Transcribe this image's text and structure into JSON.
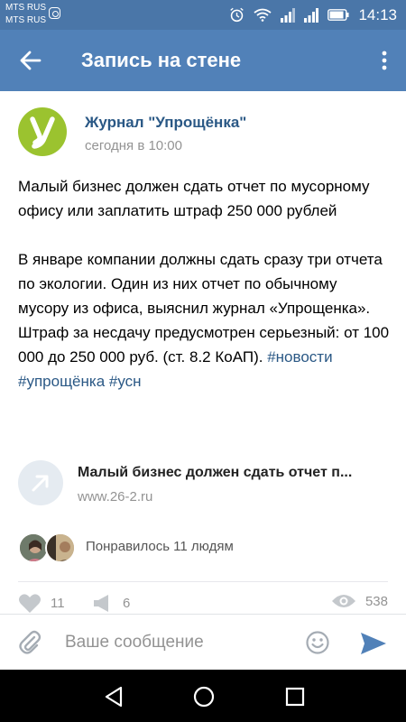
{
  "status_bar": {
    "carrier_1": "MTS RUS",
    "carrier_2": "MTS RUS",
    "time": "14:13"
  },
  "app_bar": {
    "title": "Запись на стене"
  },
  "post": {
    "author": "Журнал \"Упрощёнка\"",
    "date": "сегодня в 10:00",
    "headline": "Малый бизнес должен сдать отчет по мусорному офису или заплатить штраф 250 000 рублей",
    "body": "В январе компании должны сдать сразу три отчета по экологии. Один из них отчет по обычному мусору из офиса, выяснил журнал «Упрощенка». Штраф за несдачу предусмотрен серьезный: от 100 000 до 250 000 руб. (ст. 8.2 КоАП). ",
    "hashtags": [
      "#новости",
      "#упрощёнка",
      "#усн"
    ],
    "link": {
      "title": "Малый бизнес должен сдать отчет п...",
      "url": "www.26-2.ru"
    },
    "likers_text": "Понравилось 11 людям",
    "stats": {
      "likes": "11",
      "shares": "6",
      "views": "538"
    }
  },
  "composer": {
    "placeholder": "Ваше сообщение"
  },
  "colors": {
    "status_bar": "#4a76a8",
    "app_bar": "#5181b8",
    "link": "#2a5885",
    "avatar_green": "#9bc32f",
    "muted": "#939393"
  }
}
